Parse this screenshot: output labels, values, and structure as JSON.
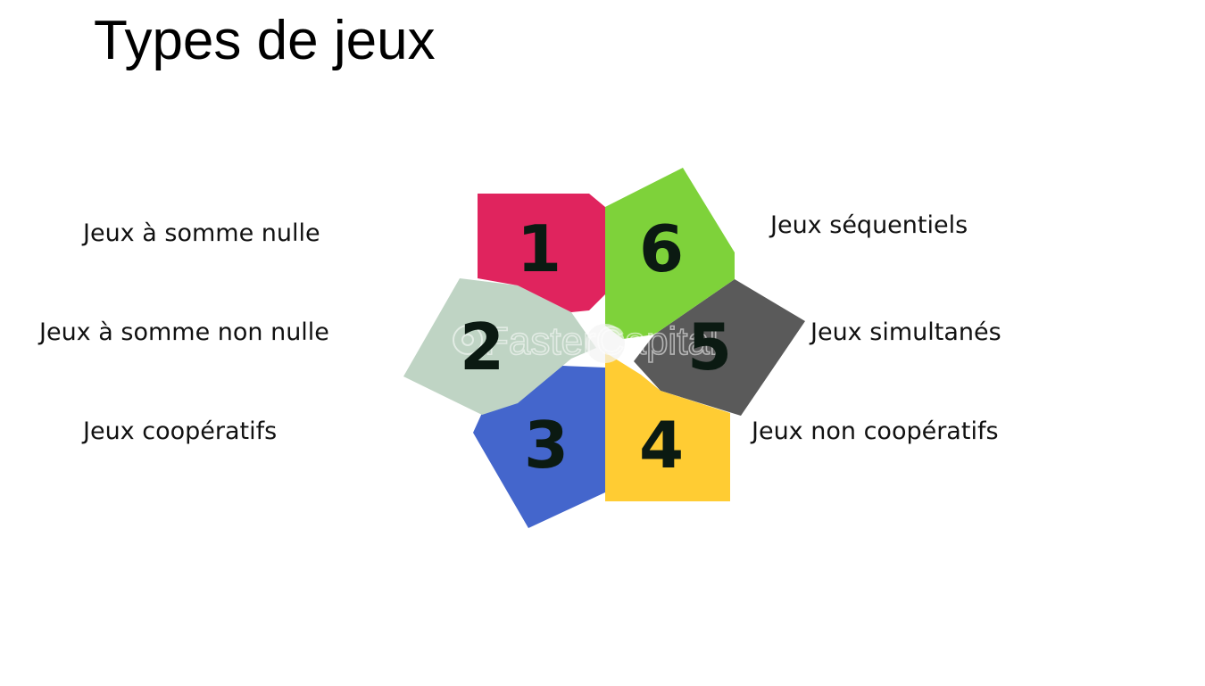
{
  "slide": {
    "title": "Types de jeux"
  },
  "items": [
    {
      "number": "1",
      "label": "Jeux à somme nulle",
      "color": "#e0245e"
    },
    {
      "number": "2",
      "label": "Jeux à somme non nulle",
      "color": "#bfd4c4"
    },
    {
      "number": "3",
      "label": "Jeux coopératifs",
      "color": "#4466cc"
    },
    {
      "number": "4",
      "label": "Jeux non coopératifs",
      "color": "#ffcc33"
    },
    {
      "number": "5",
      "label": "Jeux simultanés",
      "color": "#5a5a5a"
    },
    {
      "number": "6",
      "label": "Jeux séquentiels",
      "color": "#7ed23a"
    }
  ],
  "watermark": "FasterCapital",
  "icons": {
    "watermark_logo": "gear-logo-icon"
  }
}
